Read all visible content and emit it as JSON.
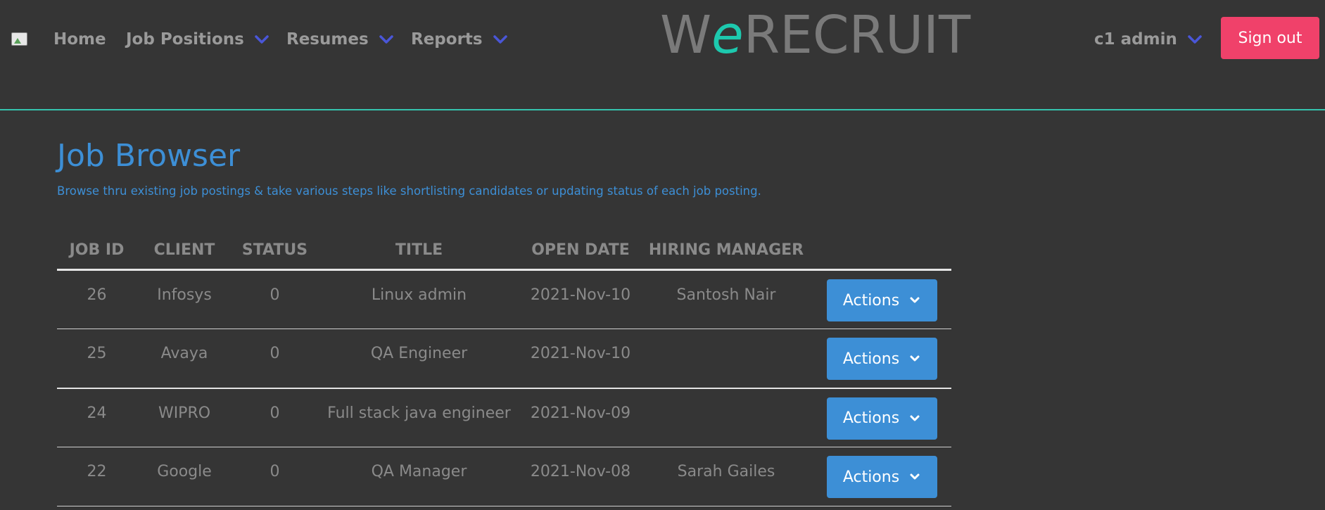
{
  "nav": {
    "logo_icon": "broken-image-icon",
    "home": "Home",
    "job_positions": "Job Positions",
    "resumes": "Resumes",
    "reports": "Reports",
    "chevron_icon": "chevron-down-icon",
    "chevron_color": "#4a56d8"
  },
  "brand": {
    "part1": "W",
    "part2": "e",
    "part3": "RECRUIT",
    "accent_color": "#1dc9ae"
  },
  "user": {
    "name": "c1 admin",
    "signout_label": "Sign out",
    "signout_color": "#f0416a"
  },
  "page": {
    "title": "Job Browser",
    "subtitle": "Browse thru existing job postings & take various steps like shortlisting candidates or updating status of each job posting.",
    "accent_color": "#3d8fd6"
  },
  "table": {
    "headers": [
      "JOB ID",
      "CLIENT",
      "STATUS",
      "TITLE",
      "OPEN DATE",
      "HIRING MANAGER",
      ""
    ],
    "rows": [
      {
        "job_id": "26",
        "client": "Infosys",
        "status": "0",
        "title": "Linux admin",
        "open_date": "2021-Nov-10",
        "hiring_manager": "Santosh Nair",
        "action": "Actions"
      },
      {
        "job_id": "25",
        "client": "Avaya",
        "status": "0",
        "title": "QA Engineer",
        "open_date": "2021-Nov-10",
        "hiring_manager": "",
        "action": "Actions"
      },
      {
        "job_id": "24",
        "client": "WIPRO",
        "status": "0",
        "title": "Full stack java engineer",
        "open_date": "2021-Nov-09",
        "hiring_manager": "",
        "action": "Actions"
      },
      {
        "job_id": "22",
        "client": "Google",
        "status": "0",
        "title": "QA Manager",
        "open_date": "2021-Nov-08",
        "hiring_manager": "Sarah Gailes",
        "action": "Actions"
      }
    ]
  }
}
